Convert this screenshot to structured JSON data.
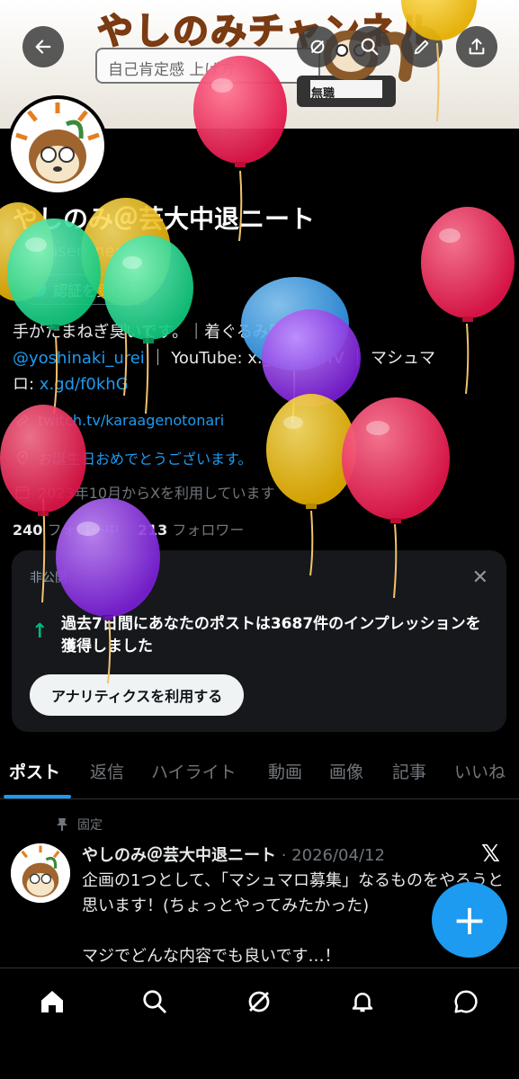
{
  "banner": {
    "title": "やしのみチャンネル",
    "search_text": "自己肯定感 上げ方",
    "badge": "無職"
  },
  "profile": {
    "name": "やしのみ＠芸大中退ニート",
    "handle": "@okusen_neet",
    "verify_label": "認証を受ける",
    "bio_line1": "手がたまねぎ臭いです。｜着ぐるみ制作者さま",
    "bio_mention": "@yoshinaki_urei",
    "bio_sep1": " ｜ YouTube: x.gd/W9OfV ｜ マシュマ",
    "bio_line3_prefix": "ロ: ",
    "bio_link": "x.gd/f0khG",
    "website": "twitch.tv/karaagenotonari",
    "birthday": "お誕生日おめでとうございます。",
    "joined": "2023年10月からXを利用しています",
    "following_count": "240",
    "following_label": "フォロー中",
    "followers_count": "213",
    "followers_label": "フォロワー"
  },
  "analytics_card": {
    "label": "非公開",
    "text": "過去7日間にあなたのポストは3687件のインプレッションを獲得しました",
    "button": "アナリティクスを利用する"
  },
  "tabs": [
    {
      "label": "ポスト",
      "active": true
    },
    {
      "label": "返信"
    },
    {
      "label": "ハイライト"
    },
    {
      "label": "動画"
    },
    {
      "label": "画像"
    },
    {
      "label": "記事"
    },
    {
      "label": "いいね"
    }
  ],
  "post": {
    "pinned_label": "固定",
    "author": "やしのみ＠芸大中退ニート",
    "date": "· 2026/04/12",
    "body": "企画の1つとして、「マシュマロ募集」なるものをやろうと思います！(ちょっとやってみたかった)\n\nマジでどんな内容でも良いです…！"
  },
  "colors": {
    "accent": "#1d9bf0",
    "background": "#000000",
    "muted": "#71767b",
    "card": "#16181c",
    "impression_up": "#00ba7c"
  },
  "icons": {
    "back": "back-arrow-icon",
    "grok": "grok-icon",
    "search": "search-icon",
    "edit": "pencil-icon",
    "share": "share-icon",
    "fab": "plus-icon"
  }
}
